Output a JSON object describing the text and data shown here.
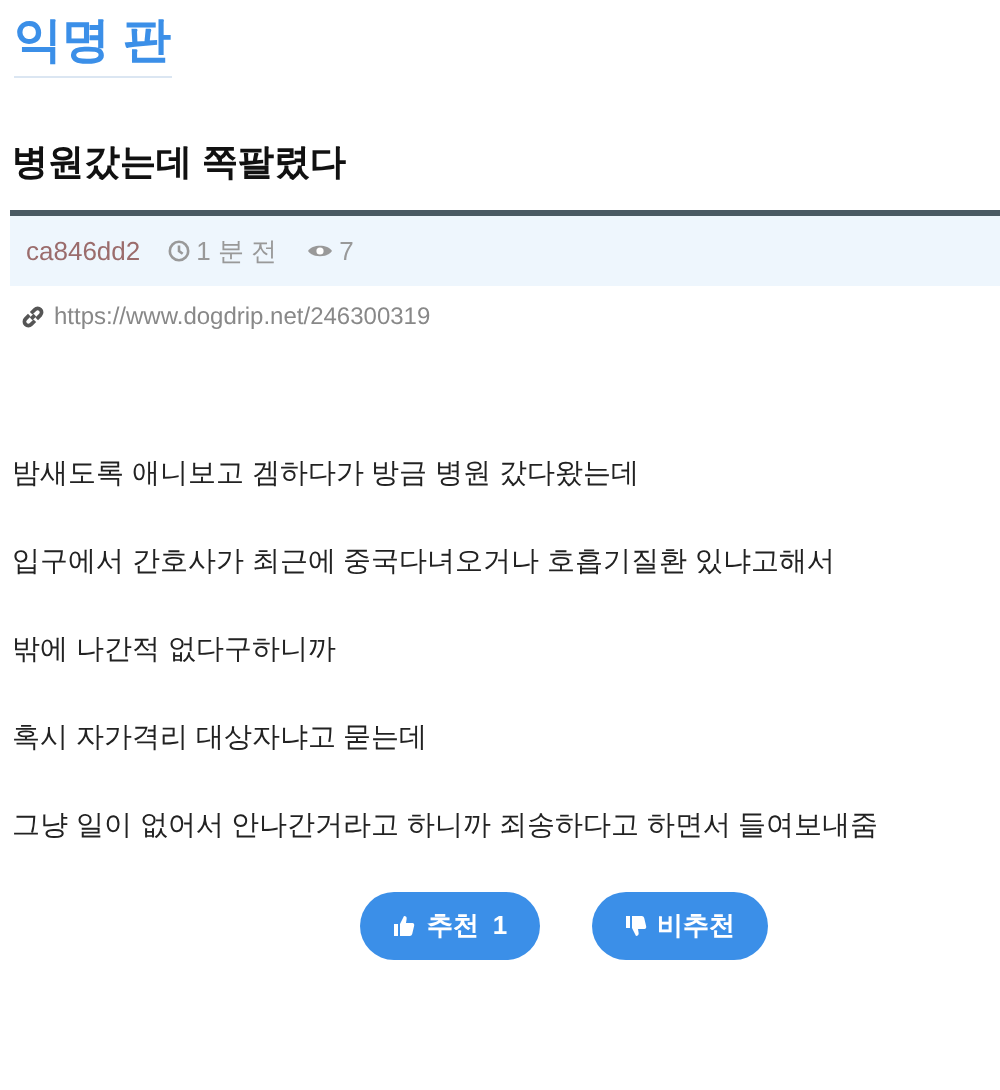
{
  "board_title": "익명 판",
  "post": {
    "title": "병원갔는데 쪽팔렸다",
    "author": "ca846dd2",
    "time": "1 분 전",
    "views": "7",
    "url": "https://www.dogdrip.net/246300319",
    "paragraphs": [
      "밤새도록 애니보고 겜하다가 방금 병원 갔다왔는데",
      "입구에서 간호사가 최근에 중국다녀오거나 호흡기질환 있냐고해서",
      "밖에 나간적 없다구하니까",
      "혹시 자가격리 대상자냐고 묻는데",
      "그냥 일이 없어서 안나간거라고 하니까 죄송하다고 하면서 들여보내줌"
    ]
  },
  "votes": [
    {
      "kind": "up",
      "label": "추천",
      "count": "1"
    },
    {
      "kind": "down",
      "label": "비추천"
    }
  ]
}
